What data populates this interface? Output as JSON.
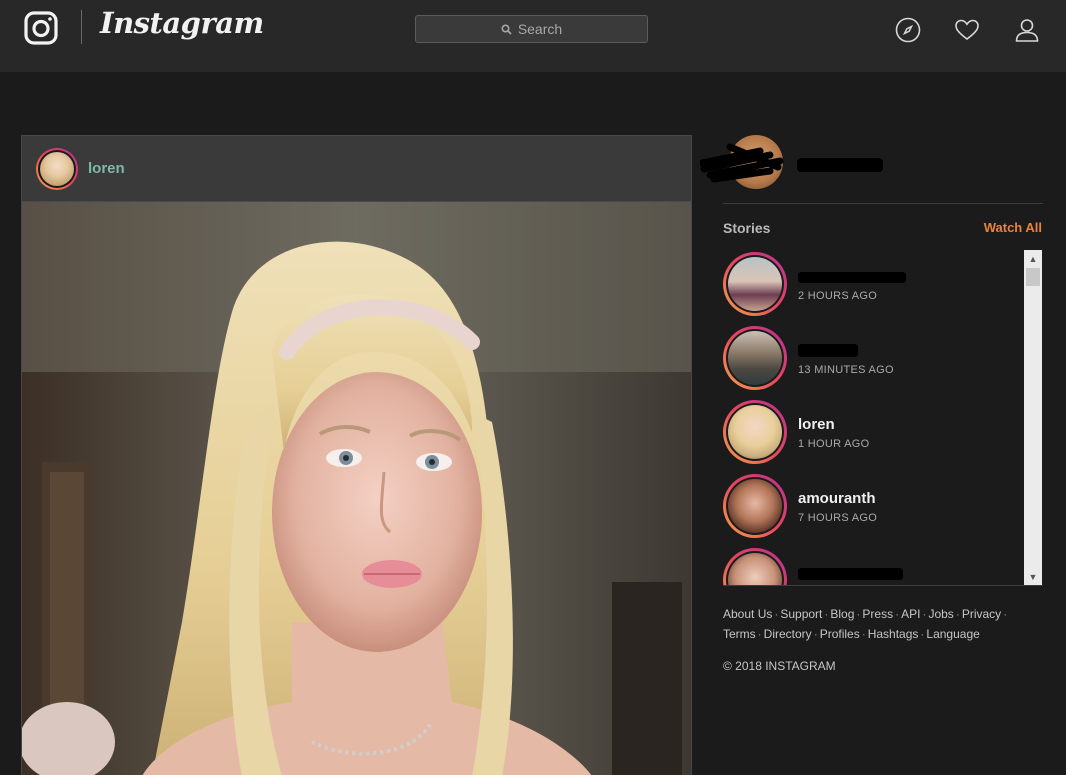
{
  "brand": {
    "wordmark": "Instagram"
  },
  "search": {
    "placeholder": "Search"
  },
  "nav_icons": [
    "compass-icon",
    "heart-icon",
    "profile-icon"
  ],
  "post": {
    "username": "loren"
  },
  "sidebar": {
    "stories_label": "Stories",
    "watch_all": "Watch All",
    "stories": [
      {
        "name": "",
        "time": "2 HOURS AGO"
      },
      {
        "name": "",
        "time": "13 MINUTES AGO"
      },
      {
        "name": "loren",
        "time": "1 HOUR AGO"
      },
      {
        "name": "amouranth",
        "time": "7 HOURS AGO"
      },
      {
        "name": "",
        "time": ""
      }
    ]
  },
  "footer": {
    "links": [
      "About Us",
      "Support",
      "Blog",
      "Press",
      "API",
      "Jobs",
      "Privacy",
      "Terms",
      "Directory",
      "Profiles",
      "Hashtags",
      "Language"
    ],
    "copyright": "© 2018 INSTAGRAM"
  },
  "colors": {
    "accent": "#e8823e",
    "username": "#7fb8a8",
    "background": "#1b1b1b",
    "topbar": "#282828"
  }
}
